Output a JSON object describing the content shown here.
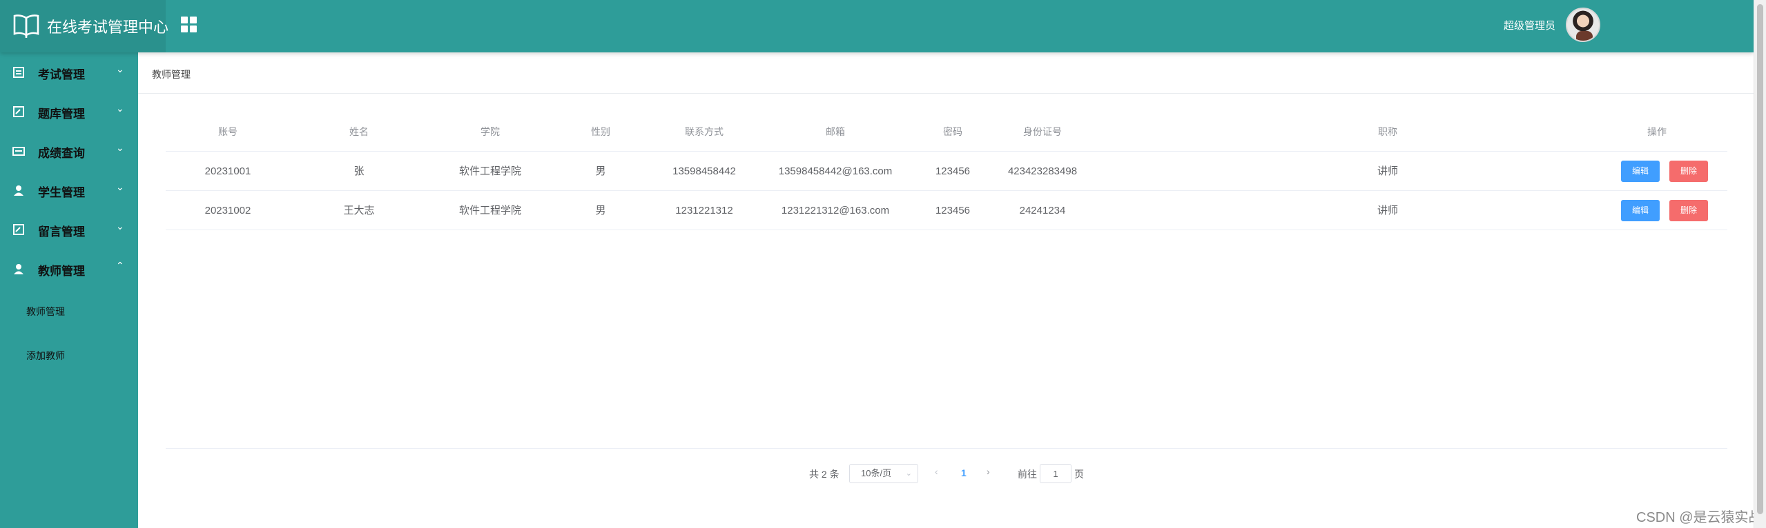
{
  "header": {
    "title": "在线考试管理中心",
    "user_name": "超级管理员",
    "book_icon": "book-open-icon",
    "grid_icon": "grid-icon"
  },
  "sidebar": {
    "items": [
      {
        "label": "考试管理",
        "icon": "list-icon",
        "expanded": false
      },
      {
        "label": "题库管理",
        "icon": "edit-doc-icon",
        "expanded": false
      },
      {
        "label": "成绩查询",
        "icon": "card-icon",
        "expanded": false
      },
      {
        "label": "学生管理",
        "icon": "user-icon",
        "expanded": false
      },
      {
        "label": "留言管理",
        "icon": "message-icon",
        "expanded": false
      },
      {
        "label": "教师管理",
        "icon": "user-icon",
        "expanded": true
      }
    ],
    "sub_items": [
      {
        "label": "教师管理"
      },
      {
        "label": "添加教师"
      }
    ]
  },
  "breadcrumb": "教师管理",
  "table": {
    "headers": [
      "账号",
      "姓名",
      "学院",
      "性别",
      "联系方式",
      "邮箱",
      "密码",
      "身份证号",
      "职称",
      "操作"
    ],
    "rows": [
      [
        "20231001",
        "张",
        "软件工程学院",
        "男",
        "13598458442",
        "13598458442@163.com",
        "123456",
        "423423283498",
        "讲师"
      ],
      [
        "20231002",
        "王大志",
        "软件工程学院",
        "男",
        "1231221312",
        "1231221312@163.com",
        "123456",
        "24241234",
        "讲师"
      ]
    ],
    "edit_label": "编辑",
    "delete_label": "删除"
  },
  "pagination": {
    "total": "共 2 条",
    "page_size": "10条/页",
    "current_page": "1",
    "goto_label": "前往",
    "goto_value": "1",
    "page_unit": "页"
  },
  "watermark": "CSDN @是云猿实战",
  "colors": {
    "primary": "#2e9d99",
    "edit": "#409eff",
    "delete": "#f56c6c"
  }
}
